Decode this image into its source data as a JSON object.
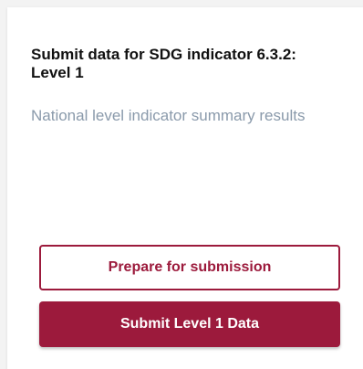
{
  "card": {
    "title": "Submit data for SDG indicator 6.3.2: Level 1",
    "subtitle": "National level indicator summary results",
    "prepare_button_label": "Prepare for submission",
    "submit_button_label": "Submit Level 1 Data"
  },
  "colors": {
    "accent": "#9c1a3c",
    "title_text": "#111111",
    "subtitle_text": "#8a9aab",
    "card_background": "#ffffff",
    "page_background": "#f3f3f3"
  }
}
